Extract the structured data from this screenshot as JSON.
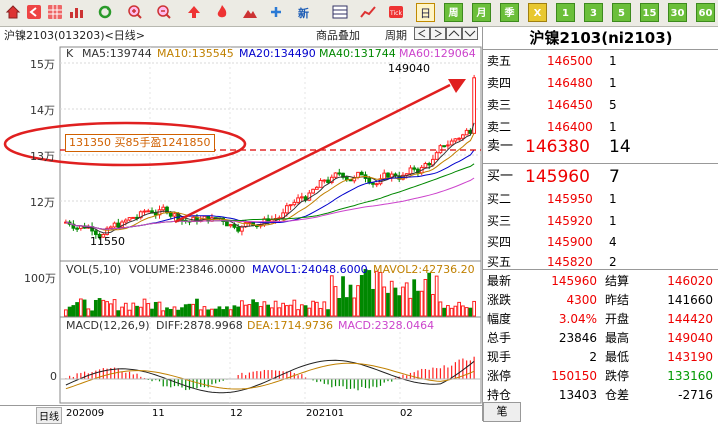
{
  "toolbar": {
    "icons": [
      "home-icon",
      "back-icon",
      "grid-icon",
      "refresh-icon",
      "zoom-in-icon",
      "zoom-out-icon",
      "bar-chart-icon",
      "up-arrow-icon",
      "fire-icon",
      "mountain-icon",
      "plus-icon"
    ],
    "new_label": "新",
    "periods": [
      "日",
      "周",
      "月",
      "季",
      "X",
      "1",
      "3",
      "5",
      "15",
      "30",
      "60"
    ]
  },
  "chart": {
    "header": "沪镍2103(013203)<日线>",
    "k_label": "K",
    "ma": [
      {
        "label": "MA5:139744",
        "color": "#333333"
      },
      {
        "label": "MA10:135545",
        "color": "#c08000"
      },
      {
        "label": "MA20:134490",
        "color": "#0000cc"
      },
      {
        "label": "MA40:131744",
        "color": "#008800"
      },
      {
        "label": "MA60:129064",
        "color": "#cc44cc"
      }
    ],
    "links": [
      "商品叠加",
      "周期"
    ],
    "y_labels": [
      "15万",
      "14万",
      "13万",
      "12万"
    ],
    "high_label": "149040",
    "low_label": "11550",
    "annotation": {
      "price": "131350",
      "text": "买85手",
      "amount": "盈1241850"
    },
    "vol_header": {
      "title": "VOL(5,10)",
      "volume": "VOLUME:23846.0000",
      "mavol1": "MAVOL1:24048.6000",
      "mavol2": "MAVOL2:42736.20"
    },
    "vol_y": "100万",
    "macd_header": {
      "title": "MACD(12,26,9)",
      "diff": "DIFF:2878.9968",
      "dea": "DEA:1714.9736",
      "macd": "MACD:2328.0464"
    },
    "macd_zero": "0",
    "x_labels": [
      "日线",
      "202009",
      "11",
      "12",
      "202101",
      "02"
    ]
  },
  "quote": {
    "title": "沪镍2103(ni2103)",
    "asks": [
      {
        "label": "卖五",
        "price": "146500",
        "vol": "1"
      },
      {
        "label": "卖四",
        "price": "146480",
        "vol": "1"
      },
      {
        "label": "卖三",
        "price": "146450",
        "vol": "5"
      },
      {
        "label": "卖二",
        "price": "146400",
        "vol": "1"
      },
      {
        "label": "卖一",
        "price": "146380",
        "vol": "14"
      }
    ],
    "bids": [
      {
        "label": "买一",
        "price": "145960",
        "vol": "7"
      },
      {
        "label": "买二",
        "price": "145950",
        "vol": "1"
      },
      {
        "label": "买三",
        "price": "145920",
        "vol": "1"
      },
      {
        "label": "买四",
        "price": "145900",
        "vol": "4"
      },
      {
        "label": "买五",
        "price": "145820",
        "vol": "2"
      }
    ],
    "stats": [
      {
        "l1": "最新",
        "v1": "145960",
        "c1": "red",
        "l2": "结算",
        "v2": "146020",
        "c2": "red"
      },
      {
        "l1": "涨跌",
        "v1": "4300",
        "c1": "red",
        "l2": "昨结",
        "v2": "141660",
        "c2": "black"
      },
      {
        "l1": "幅度",
        "v1": "3.04%",
        "c1": "red",
        "l2": "开盘",
        "v2": "144420",
        "c2": "red"
      },
      {
        "l1": "总手",
        "v1": "23846",
        "c1": "black",
        "l2": "最高",
        "v2": "149040",
        "c2": "red"
      },
      {
        "l1": "现手",
        "v1": "2",
        "c1": "black",
        "l2": "最低",
        "v2": "143190",
        "c2": "red"
      },
      {
        "l1": "涨停",
        "v1": "150150",
        "c1": "red",
        "l2": "跌停",
        "v2": "133160",
        "c2": "green"
      },
      {
        "l1": "持仓",
        "v1": "13403",
        "c1": "black",
        "l2": "仓差",
        "v2": "-2716",
        "c2": "black"
      }
    ],
    "bottom_tab": "笔"
  },
  "chart_data": {
    "type": "candlestick",
    "title": "沪镍2103(013203)<日线>",
    "ylim": [
      110000,
      152000
    ],
    "x_ticks": [
      "202009",
      "11",
      "12",
      "202101",
      "02"
    ],
    "y_ticks": [
      "15万",
      "14万",
      "13万",
      "12万"
    ],
    "high": 149040,
    "low": 115500,
    "annotation_price": 131350,
    "moving_averages": {
      "MA5": 139744,
      "MA10": 135545,
      "MA20": 134490,
      "MA40": 131744,
      "MA60": 129064
    },
    "volume": {
      "VOLUME": 23846,
      "MAVOL1": 24048.6,
      "MAVOL2": 42736.2
    },
    "macd": {
      "DIFF": 2878.9968,
      "DEA": 1714.9736,
      "MACD": 2328.0464
    }
  },
  "colors": {
    "up": "#ff2020",
    "down": "#008800",
    "accent": "#e00000"
  }
}
